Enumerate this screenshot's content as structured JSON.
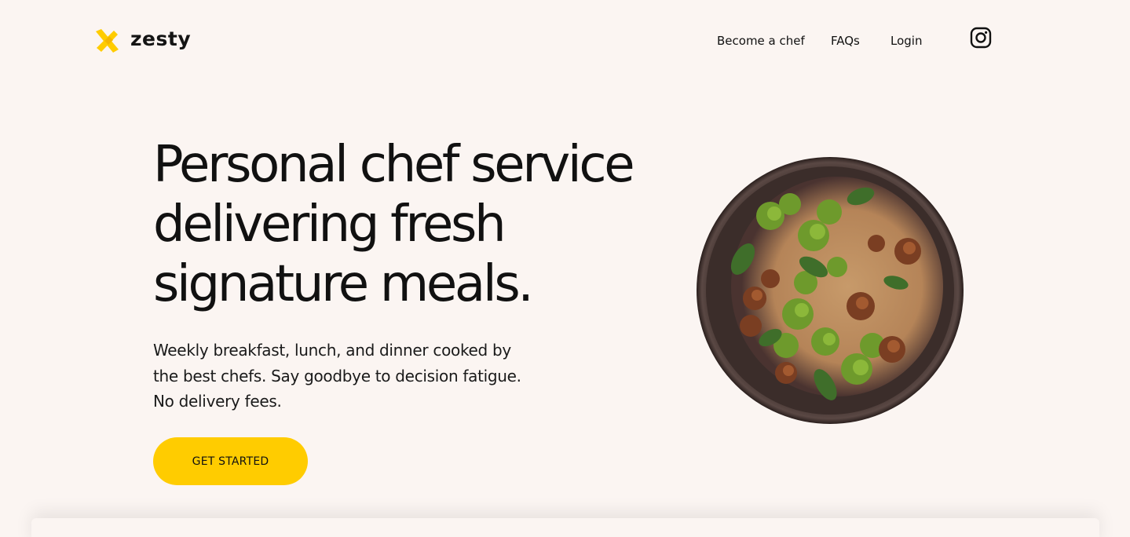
{
  "brand": {
    "name": "zesty",
    "accent_color": "#ffcc00",
    "logo_icon": "zesty-x-logo-icon"
  },
  "nav": {
    "links": [
      {
        "label": "Become a chef"
      },
      {
        "label": "FAQs"
      },
      {
        "label": "Login"
      }
    ],
    "social_icon": "instagram-icon"
  },
  "hero": {
    "title": "Personal chef service delivering fresh signature meals.",
    "title_lines": [
      "Personal chef service",
      "delivering fresh",
      "signature meals."
    ],
    "subtitle_lines": [
      "Weekly breakfast, lunch, and dinner cooked by",
      "the best chefs. Say goodbye to decision fatigue.",
      "No delivery fees."
    ],
    "cta_label": "GET STARTED",
    "image_icon": "food-bowl-image"
  }
}
